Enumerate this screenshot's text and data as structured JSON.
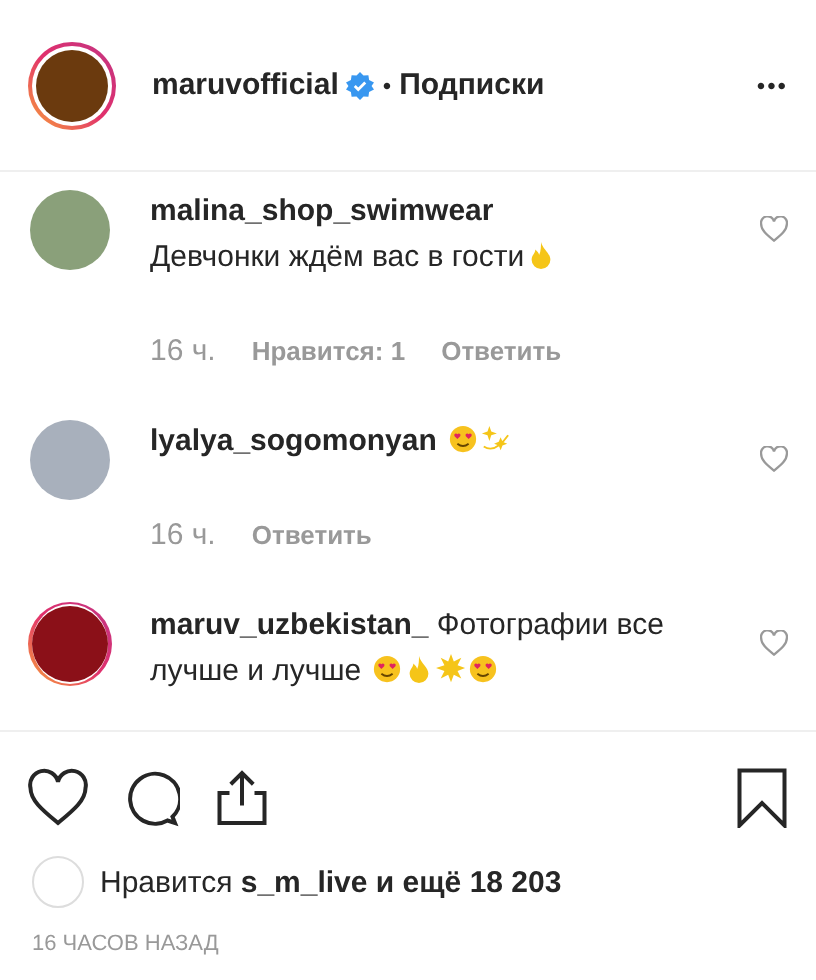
{
  "header": {
    "username": "maruvofficial",
    "verified": true,
    "story_ring": true,
    "separator": "•",
    "follow_label": "Подписки",
    "more": "•••"
  },
  "comments": [
    {
      "username": "malina_shop_swimwear",
      "text": "Девчонки ждём вас в гости",
      "text_inline": false,
      "emojis": [
        {
          "kind": "fire"
        }
      ],
      "story_ring": false,
      "time": "16 ч.",
      "likes": "Нравится: 1",
      "reply": "Ответить"
    },
    {
      "username": "lyalya_sogomonyan",
      "text_inline": true,
      "emojis": [
        {
          "kind": "heart-eyes"
        },
        {
          "kind": "sparkles"
        }
      ],
      "story_ring": false,
      "time": "16 ч.",
      "reply": "Ответить"
    },
    {
      "username": "maruv_uzbekistan_",
      "text": "Фотографии все лучше и лучше",
      "text_inline": true,
      "emojis": [
        {
          "kind": "heart-eyes"
        },
        {
          "kind": "fire"
        },
        {
          "kind": "sparkle"
        },
        {
          "kind": "heart-eyes"
        }
      ],
      "story_ring": true
    }
  ],
  "likes": {
    "prefix": "Нравится",
    "user": "s_m_live",
    "suffix": "и ещё 18 203"
  },
  "timestamp": "16 ЧАСОВ НАЗАД"
}
